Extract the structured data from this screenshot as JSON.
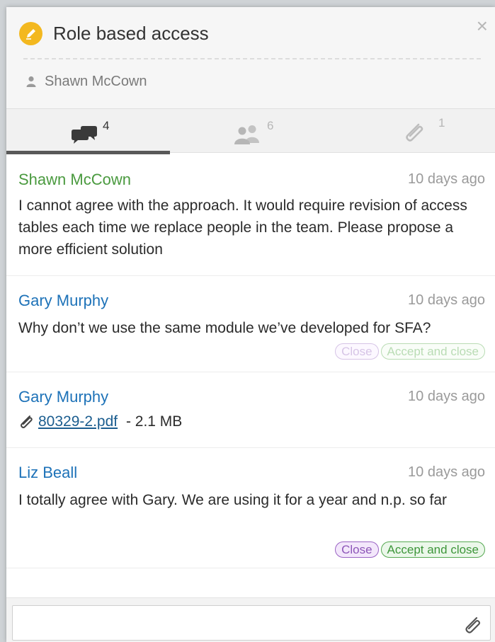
{
  "task": {
    "title": "Role based access",
    "owner": "Shawn McCown",
    "close_symbol": "×",
    "icon": "pencil-icon",
    "icon_color": "#f3b81f"
  },
  "tabs": [
    {
      "name": "comments",
      "icon": "comments-icon",
      "count": "4",
      "active": true
    },
    {
      "name": "participants",
      "icon": "people-icon",
      "count": "6",
      "active": false
    },
    {
      "name": "attachments",
      "icon": "paperclip-icon",
      "count": "1",
      "active": false
    }
  ],
  "comments": [
    {
      "author": "Shawn McCown",
      "author_color": "#4a9a3f",
      "time": "10 days ago",
      "text": "I cannot agree with the approach. It would require revision of access tables each time we replace people in the team. Please propose a more efficient solution"
    },
    {
      "author": "Gary Murphy",
      "author_color": "#1d72b8",
      "time": "10 days ago",
      "text": "Why don’t we use the same module we’ve developed for SFA?",
      "close_label": "Close",
      "accept_label": "Accept and close"
    },
    {
      "author": "Gary Murphy",
      "author_color": "#1d72b8",
      "time": "10 days ago",
      "file_name": "80329-2.pdf",
      "file_size": " - 2.1 MB"
    },
    {
      "author": "Liz Beall",
      "author_color": "#1d72b8",
      "time": "10 days ago",
      "text": "I totally agree with Gary. We are using it for a year and n.p. so far",
      "close_label": "Close",
      "accept_label": "Accept and close"
    }
  ],
  "comment_input": {
    "value": "",
    "placeholder": ""
  }
}
